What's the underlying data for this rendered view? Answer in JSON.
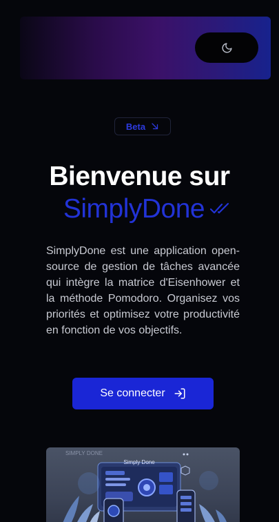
{
  "header": {
    "theme_toggle_icon": "moon-icon"
  },
  "hero": {
    "badge_label": "Beta",
    "badge_icon": "arrow-down-right-icon",
    "title_line1": "Bienvenue sur",
    "title_brand": "SimplyDone",
    "title_icon": "double-check-icon",
    "description": "SimplyDone est une application open-source de gestion de tâches avancée qui intègre la matrice d'Eisenhower et la méthode Pomodoro. Organisez vos priorités et optimisez votre productivité en fonction de vos objectifs.",
    "cta_label": "Se connecter",
    "cta_icon": "log-in-icon"
  },
  "preview": {
    "logo_text": "SIMPLY DONE",
    "screen_title": "Simply Done"
  },
  "colors": {
    "background": "#05060b",
    "accent": "#1a26d6",
    "brand_text": "#2233d6",
    "body_text": "#c9cbd3"
  }
}
